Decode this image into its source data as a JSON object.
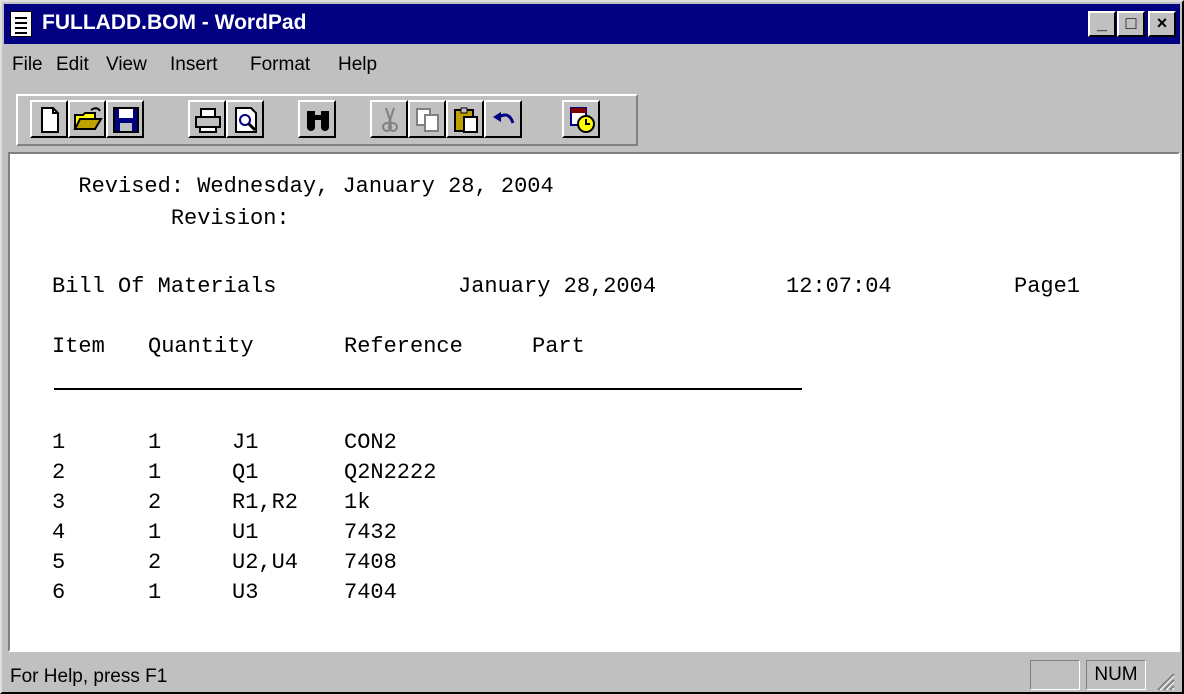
{
  "window": {
    "title": "FULLADD.BOM - WordPad",
    "controls": {
      "minimize": "_",
      "maximize": "□",
      "close": "×"
    }
  },
  "menu": [
    {
      "label": "File"
    },
    {
      "label": "Edit"
    },
    {
      "label": "View"
    },
    {
      "label": "Insert"
    },
    {
      "label": "Format"
    },
    {
      "label": "Help"
    }
  ],
  "toolbar": {
    "buttons": [
      {
        "icon": "new-icon"
      },
      {
        "icon": "open-icon"
      },
      {
        "icon": "save-icon"
      },
      {
        "icon": "print-icon"
      },
      {
        "icon": "print-preview-icon"
      },
      {
        "icon": "find-icon"
      },
      {
        "icon": "cut-icon"
      },
      {
        "icon": "copy-icon"
      },
      {
        "icon": "paste-icon"
      },
      {
        "icon": "undo-icon"
      },
      {
        "icon": "date-time-icon"
      }
    ]
  },
  "document": {
    "revised": "  Revised: Wednesday, January 28, 2004",
    "revision": "         Revision:",
    "header": {
      "title": "Bill Of Materials",
      "date": "January 28,2004",
      "time": "12:07:04",
      "page": "Page1"
    },
    "columns": {
      "item": "Item",
      "quantity": "Quantity",
      "reference": "Reference",
      "part": "Part"
    },
    "rows": [
      {
        "item": "1",
        "quantity": "1",
        "reference": "J1",
        "part": "CON2"
      },
      {
        "item": "2",
        "quantity": "1",
        "reference": "Q1",
        "part": "Q2N2222"
      },
      {
        "item": "3",
        "quantity": "2",
        "reference": "R1,R2",
        "part": "1k"
      },
      {
        "item": "4",
        "quantity": "1",
        "reference": "U1",
        "part": "7432"
      },
      {
        "item": "5",
        "quantity": "2",
        "reference": "U2,U4",
        "part": "7408"
      },
      {
        "item": "6",
        "quantity": "1",
        "reference": "U3",
        "part": "7404"
      }
    ]
  },
  "status": {
    "help_text": "For Help, press F1",
    "panel_blank": "",
    "num": "NUM"
  }
}
